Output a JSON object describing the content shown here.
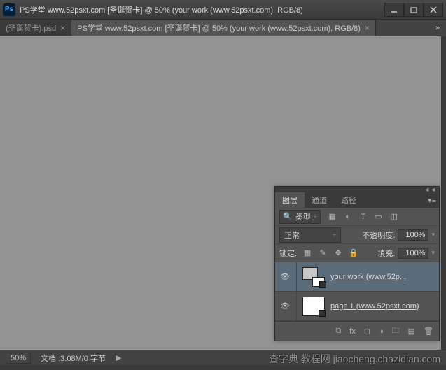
{
  "titlebar": {
    "app_icon_text": "Ps",
    "title": "PS学堂 www.52psxt.com [圣诞贺卡] @ 50% (your work (www.52psxt.com), RGB/8)"
  },
  "tabs": {
    "items": [
      {
        "label": "(圣诞贺卡).psd"
      },
      {
        "label": "PS学堂 www.52psxt.com [圣诞贺卡] @ 50% (your work (www.52psxt.com), RGB/8)"
      }
    ],
    "close_glyph": "×",
    "overflow_glyph": "»"
  },
  "layers_panel": {
    "tabs": {
      "layers": "图层",
      "channels": "通道",
      "paths": "路径"
    },
    "filter": {
      "search_glyph": "🔍",
      "label": "类型",
      "dropdown_glyph": "÷"
    },
    "blend_mode": {
      "label": "正常"
    },
    "opacity": {
      "label": "不透明度:",
      "value": "100%"
    },
    "lock": {
      "label": "锁定:"
    },
    "fill": {
      "label": "填充:",
      "value": "100%"
    },
    "layers": [
      {
        "name": "your work (www.52p...",
        "visible": true
      },
      {
        "name": "page 1 (www.52psxt.com)",
        "visible": true
      }
    ],
    "collapse_glyph": "◄◄",
    "menu_glyph": "▾≡"
  },
  "statusbar": {
    "zoom": "50%",
    "doc_info": "文档 :3.08M/0 字节",
    "arrow_glyph": "▶"
  },
  "watermark": "查字典  教程网  jiaocheng.chazidian.com",
  "icons": {
    "image": "▦",
    "adjust": "◐",
    "text": "T",
    "shape": "▭",
    "smart": "◫",
    "lock_pixels": "▦",
    "lock_brush": "✎",
    "lock_move": "✥",
    "lock_all": "🔒",
    "link": "⧉",
    "fx": "fx",
    "mask": "◻",
    "adjlayer": "◑",
    "folder": "🗀",
    "newlayer": "▤",
    "trash": "🗑",
    "eye": "👁",
    "dropdown": "÷",
    "chev": "▾"
  }
}
